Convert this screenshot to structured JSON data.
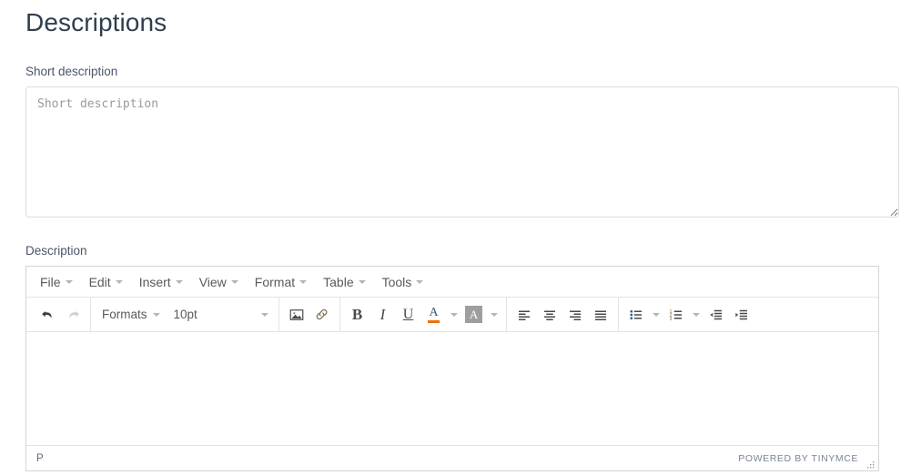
{
  "page": {
    "title": "Descriptions"
  },
  "short_description": {
    "label": "Short description",
    "placeholder": "Short description",
    "value": ""
  },
  "description": {
    "label": "Description",
    "editor": {
      "menubar": [
        {
          "label": "File",
          "icon": "chevron-down-icon"
        },
        {
          "label": "Edit",
          "icon": "chevron-down-icon"
        },
        {
          "label": "Insert",
          "icon": "chevron-down-icon"
        },
        {
          "label": "View",
          "icon": "chevron-down-icon"
        },
        {
          "label": "Format",
          "icon": "chevron-down-icon"
        },
        {
          "label": "Table",
          "icon": "chevron-down-icon"
        },
        {
          "label": "Tools",
          "icon": "chevron-down-icon"
        }
      ],
      "toolbar": {
        "undo": "undo-icon",
        "redo": "redo-icon",
        "formats_label": "Formats",
        "fontsize_value": "10pt",
        "image": "image-icon",
        "link": "link-icon",
        "bold": "B",
        "italic": "I",
        "underline": "U",
        "forecolor": "A",
        "backcolor": "A",
        "align_left": "align-left-icon",
        "align_center": "align-center-icon",
        "align_right": "align-right-icon",
        "align_justify": "align-justify-icon",
        "bullist": "bullet-list-icon",
        "numlist": "numbered-list-icon",
        "outdent": "outdent-icon",
        "indent": "indent-icon"
      },
      "content": "",
      "statusbar": {
        "element_path": "P",
        "branding": "POWERED BY TINYMCE"
      }
    }
  },
  "colors": {
    "heading": "#2f3e4e",
    "label": "#4a5568",
    "border": "#d5d5d5",
    "forecolor_bar": "#e8710a",
    "backcolor_swatch": "#9e9e9e",
    "icon": "#4a4a4a",
    "icon_accent": "#3d5a80"
  }
}
